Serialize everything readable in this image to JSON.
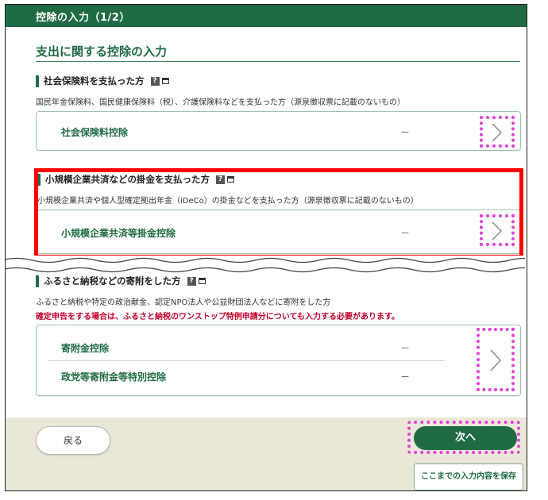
{
  "header": {
    "title": "控除の入力（1/2）"
  },
  "section": {
    "title": "支出に関する控除の入力"
  },
  "social_insurance": {
    "heading": "社会保険料を支払った方",
    "help_icon": "help-icon",
    "desc": "国民年金保険料、国民健康保険料（税）、介護保険料などを支払った方（源泉徴収票に記載のないもの）",
    "item_label": "社会保険料控除",
    "item_value": "－"
  },
  "small_business": {
    "heading": "小規模企業共済などの掛金を支払った方",
    "desc": "小規模企業共済や個人型確定拠出年金（iDeCo）の掛金などを支払った方（源泉徴収票に記載のないもの）",
    "item_label": "小規模企業共済等掛金控除",
    "item_value": "－"
  },
  "donation": {
    "heading": "ふるさと納税などの寄附をした方",
    "desc": "ふるさと納税や特定の政治献金、認定NPO法人や公益財団法人などに寄附をした方",
    "note": "確定申告をする場合は、ふるさと納税のワンストップ特例申請分についても入力する必要があります。",
    "items": [
      {
        "label": "寄附金控除",
        "value": "－"
      },
      {
        "label": "政党等寄附金等特別控除",
        "value": "－"
      }
    ]
  },
  "footer": {
    "back_label": "戻る",
    "next_label": "次へ",
    "save_label": "ここまでの入力内容を保存"
  },
  "colors": {
    "brand": "#1f6b44",
    "highlight": "#ff0000",
    "marker": "#e040d6",
    "footer_bg": "#eae6d8",
    "note": "#c4002b"
  }
}
